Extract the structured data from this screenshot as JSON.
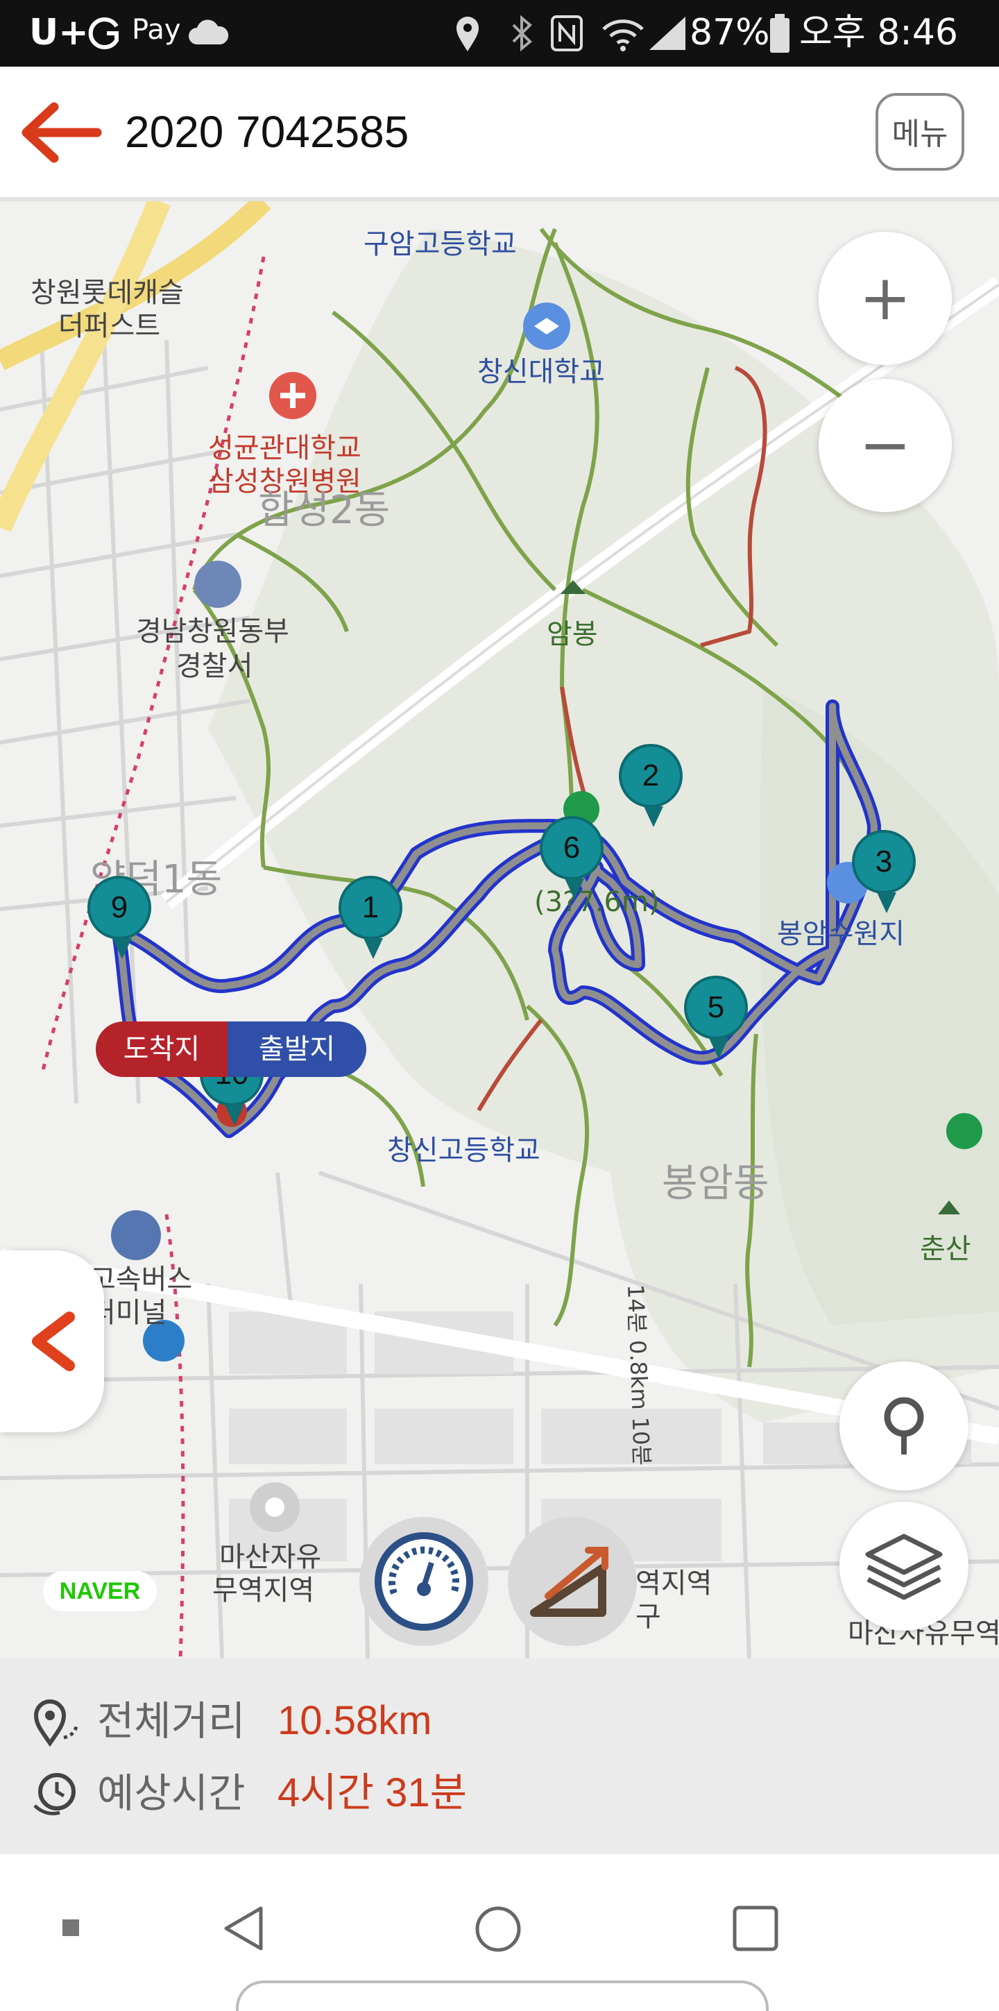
{
  "status_bar": {
    "carrier": "U+",
    "pay": "Pay",
    "battery": "87%",
    "time": "오후 8:46"
  },
  "header": {
    "title": "2020 7042585",
    "menu_label": "메뉴"
  },
  "map": {
    "labels": {
      "lotte_castle": "창원롯데캐슬",
      "lotte_castle2": "더퍼스트",
      "guam_school": "구암고등학교",
      "changshin_univ": "창신대학교",
      "hospital1": "성균관대학교",
      "hospital2": "삼성창원병원",
      "hapseong2": "합성2동",
      "police1": "경남창원동부",
      "police2": "경찰서",
      "ambong": "암봉",
      "yangdeok1": "양덕1동",
      "peak_elev": "(3?7.6m)",
      "reservoir": "봉암수원지",
      "changshin_high": "창신고등학교",
      "bongam_dong": "봉암동",
      "trail_note": "14분 0.8km 10분",
      "chunsan": "춘산",
      "bus_terminal1": "고속버스",
      "bus_terminal2": "터미널",
      "free_trade1": "마산자유",
      "free_trade2": "무역지역",
      "free_trade3": "역지역",
      "free_trade4": "구",
      "free_trade5": "마산자유무역"
    },
    "markers": [
      "1",
      "2",
      "3",
      "5",
      "6",
      "9",
      "10"
    ],
    "arrive_label": "도착지",
    "depart_label": "출발지",
    "naver_logo": "NAVER",
    "zoom_in": "+",
    "zoom_out": "−"
  },
  "info": {
    "distance_label": "전체거리",
    "distance_value": "10.58km",
    "time_label": "예상시간",
    "time_value": "4시간 31분"
  },
  "colors": {
    "accent": "#cc3b1c",
    "route": "#2233cc",
    "marker": "#138e96",
    "trail": "#7ea34a"
  }
}
